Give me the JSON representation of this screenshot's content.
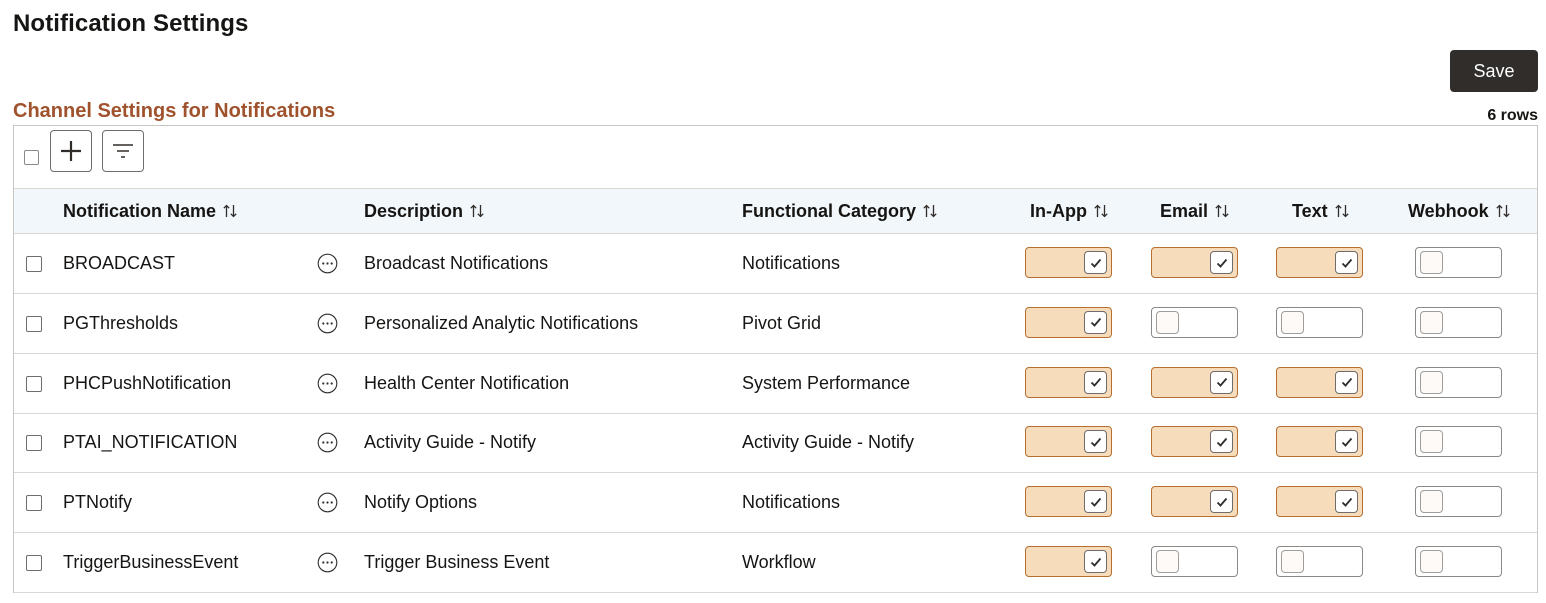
{
  "page": {
    "title": "Notification Settings",
    "save_label": "Save"
  },
  "grid": {
    "title": "Channel Settings for Notifications",
    "row_count": "6 rows",
    "toolbar": {
      "add_icon": "plus-icon",
      "filter_icon": "filter-icon"
    },
    "columns": [
      {
        "label": "Notification Name"
      },
      {
        "label": "Description"
      },
      {
        "label": "Functional Category"
      },
      {
        "label": "In-App"
      },
      {
        "label": "Email"
      },
      {
        "label": "Text"
      },
      {
        "label": "Webhook"
      }
    ],
    "rows": [
      {
        "name": "BROADCAST",
        "description": "Broadcast Notifications",
        "category": "Notifications",
        "in_app": true,
        "email": true,
        "text": true,
        "webhook": false
      },
      {
        "name": "PGThresholds",
        "description": "Personalized Analytic Notifications",
        "category": "Pivot Grid",
        "in_app": true,
        "email": false,
        "text": false,
        "webhook": false
      },
      {
        "name": "PHCPushNotification",
        "description": "Health Center Notification",
        "category": "System Performance",
        "in_app": true,
        "email": true,
        "text": true,
        "webhook": false
      },
      {
        "name": "PTAI_NOTIFICATION",
        "description": "Activity Guide - Notify",
        "category": "Activity Guide - Notify",
        "in_app": true,
        "email": true,
        "text": true,
        "webhook": false
      },
      {
        "name": "PTNotify",
        "description": "Notify Options",
        "category": "Notifications",
        "in_app": true,
        "email": true,
        "text": true,
        "webhook": false
      },
      {
        "name": "TriggerBusinessEvent",
        "description": "Trigger Business Event",
        "category": "Workflow",
        "in_app": true,
        "email": false,
        "text": false,
        "webhook": false
      }
    ]
  },
  "colors": {
    "accent_title": "#a0522d",
    "toggle_on_fill": "#f7dcbb",
    "toggle_on_border": "#b76f31",
    "header_bg": "#f1f7fb",
    "save_bg": "#312d2a"
  }
}
